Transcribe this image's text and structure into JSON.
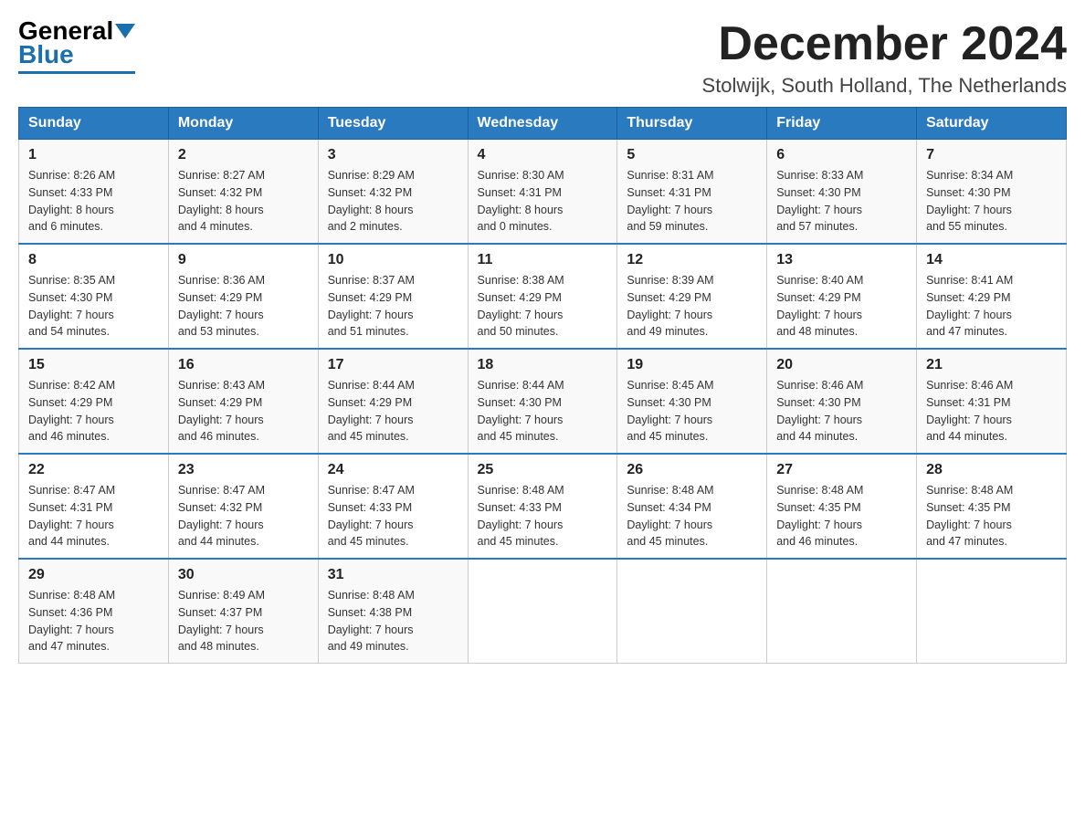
{
  "logo": {
    "general": "General",
    "blue": "Blue"
  },
  "title": {
    "month_year": "December 2024",
    "location": "Stolwijk, South Holland, The Netherlands"
  },
  "days_of_week": [
    "Sunday",
    "Monday",
    "Tuesday",
    "Wednesday",
    "Thursday",
    "Friday",
    "Saturday"
  ],
  "weeks": [
    [
      {
        "day": "1",
        "sunrise": "8:26 AM",
        "sunset": "4:33 PM",
        "daylight": "8 hours and 6 minutes."
      },
      {
        "day": "2",
        "sunrise": "8:27 AM",
        "sunset": "4:32 PM",
        "daylight": "8 hours and 4 minutes."
      },
      {
        "day": "3",
        "sunrise": "8:29 AM",
        "sunset": "4:32 PM",
        "daylight": "8 hours and 2 minutes."
      },
      {
        "day": "4",
        "sunrise": "8:30 AM",
        "sunset": "4:31 PM",
        "daylight": "8 hours and 0 minutes."
      },
      {
        "day": "5",
        "sunrise": "8:31 AM",
        "sunset": "4:31 PM",
        "daylight": "7 hours and 59 minutes."
      },
      {
        "day": "6",
        "sunrise": "8:33 AM",
        "sunset": "4:30 PM",
        "daylight": "7 hours and 57 minutes."
      },
      {
        "day": "7",
        "sunrise": "8:34 AM",
        "sunset": "4:30 PM",
        "daylight": "7 hours and 55 minutes."
      }
    ],
    [
      {
        "day": "8",
        "sunrise": "8:35 AM",
        "sunset": "4:30 PM",
        "daylight": "7 hours and 54 minutes."
      },
      {
        "day": "9",
        "sunrise": "8:36 AM",
        "sunset": "4:29 PM",
        "daylight": "7 hours and 53 minutes."
      },
      {
        "day": "10",
        "sunrise": "8:37 AM",
        "sunset": "4:29 PM",
        "daylight": "7 hours and 51 minutes."
      },
      {
        "day": "11",
        "sunrise": "8:38 AM",
        "sunset": "4:29 PM",
        "daylight": "7 hours and 50 minutes."
      },
      {
        "day": "12",
        "sunrise": "8:39 AM",
        "sunset": "4:29 PM",
        "daylight": "7 hours and 49 minutes."
      },
      {
        "day": "13",
        "sunrise": "8:40 AM",
        "sunset": "4:29 PM",
        "daylight": "7 hours and 48 minutes."
      },
      {
        "day": "14",
        "sunrise": "8:41 AM",
        "sunset": "4:29 PM",
        "daylight": "7 hours and 47 minutes."
      }
    ],
    [
      {
        "day": "15",
        "sunrise": "8:42 AM",
        "sunset": "4:29 PM",
        "daylight": "7 hours and 46 minutes."
      },
      {
        "day": "16",
        "sunrise": "8:43 AM",
        "sunset": "4:29 PM",
        "daylight": "7 hours and 46 minutes."
      },
      {
        "day": "17",
        "sunrise": "8:44 AM",
        "sunset": "4:29 PM",
        "daylight": "7 hours and 45 minutes."
      },
      {
        "day": "18",
        "sunrise": "8:44 AM",
        "sunset": "4:30 PM",
        "daylight": "7 hours and 45 minutes."
      },
      {
        "day": "19",
        "sunrise": "8:45 AM",
        "sunset": "4:30 PM",
        "daylight": "7 hours and 45 minutes."
      },
      {
        "day": "20",
        "sunrise": "8:46 AM",
        "sunset": "4:30 PM",
        "daylight": "7 hours and 44 minutes."
      },
      {
        "day": "21",
        "sunrise": "8:46 AM",
        "sunset": "4:31 PM",
        "daylight": "7 hours and 44 minutes."
      }
    ],
    [
      {
        "day": "22",
        "sunrise": "8:47 AM",
        "sunset": "4:31 PM",
        "daylight": "7 hours and 44 minutes."
      },
      {
        "day": "23",
        "sunrise": "8:47 AM",
        "sunset": "4:32 PM",
        "daylight": "7 hours and 44 minutes."
      },
      {
        "day": "24",
        "sunrise": "8:47 AM",
        "sunset": "4:33 PM",
        "daylight": "7 hours and 45 minutes."
      },
      {
        "day": "25",
        "sunrise": "8:48 AM",
        "sunset": "4:33 PM",
        "daylight": "7 hours and 45 minutes."
      },
      {
        "day": "26",
        "sunrise": "8:48 AM",
        "sunset": "4:34 PM",
        "daylight": "7 hours and 45 minutes."
      },
      {
        "day": "27",
        "sunrise": "8:48 AM",
        "sunset": "4:35 PM",
        "daylight": "7 hours and 46 minutes."
      },
      {
        "day": "28",
        "sunrise": "8:48 AM",
        "sunset": "4:35 PM",
        "daylight": "7 hours and 47 minutes."
      }
    ],
    [
      {
        "day": "29",
        "sunrise": "8:48 AM",
        "sunset": "4:36 PM",
        "daylight": "7 hours and 47 minutes."
      },
      {
        "day": "30",
        "sunrise": "8:49 AM",
        "sunset": "4:37 PM",
        "daylight": "7 hours and 48 minutes."
      },
      {
        "day": "31",
        "sunrise": "8:48 AM",
        "sunset": "4:38 PM",
        "daylight": "7 hours and 49 minutes."
      },
      null,
      null,
      null,
      null
    ]
  ],
  "labels": {
    "sunrise": "Sunrise:",
    "sunset": "Sunset:",
    "daylight": "Daylight:"
  }
}
